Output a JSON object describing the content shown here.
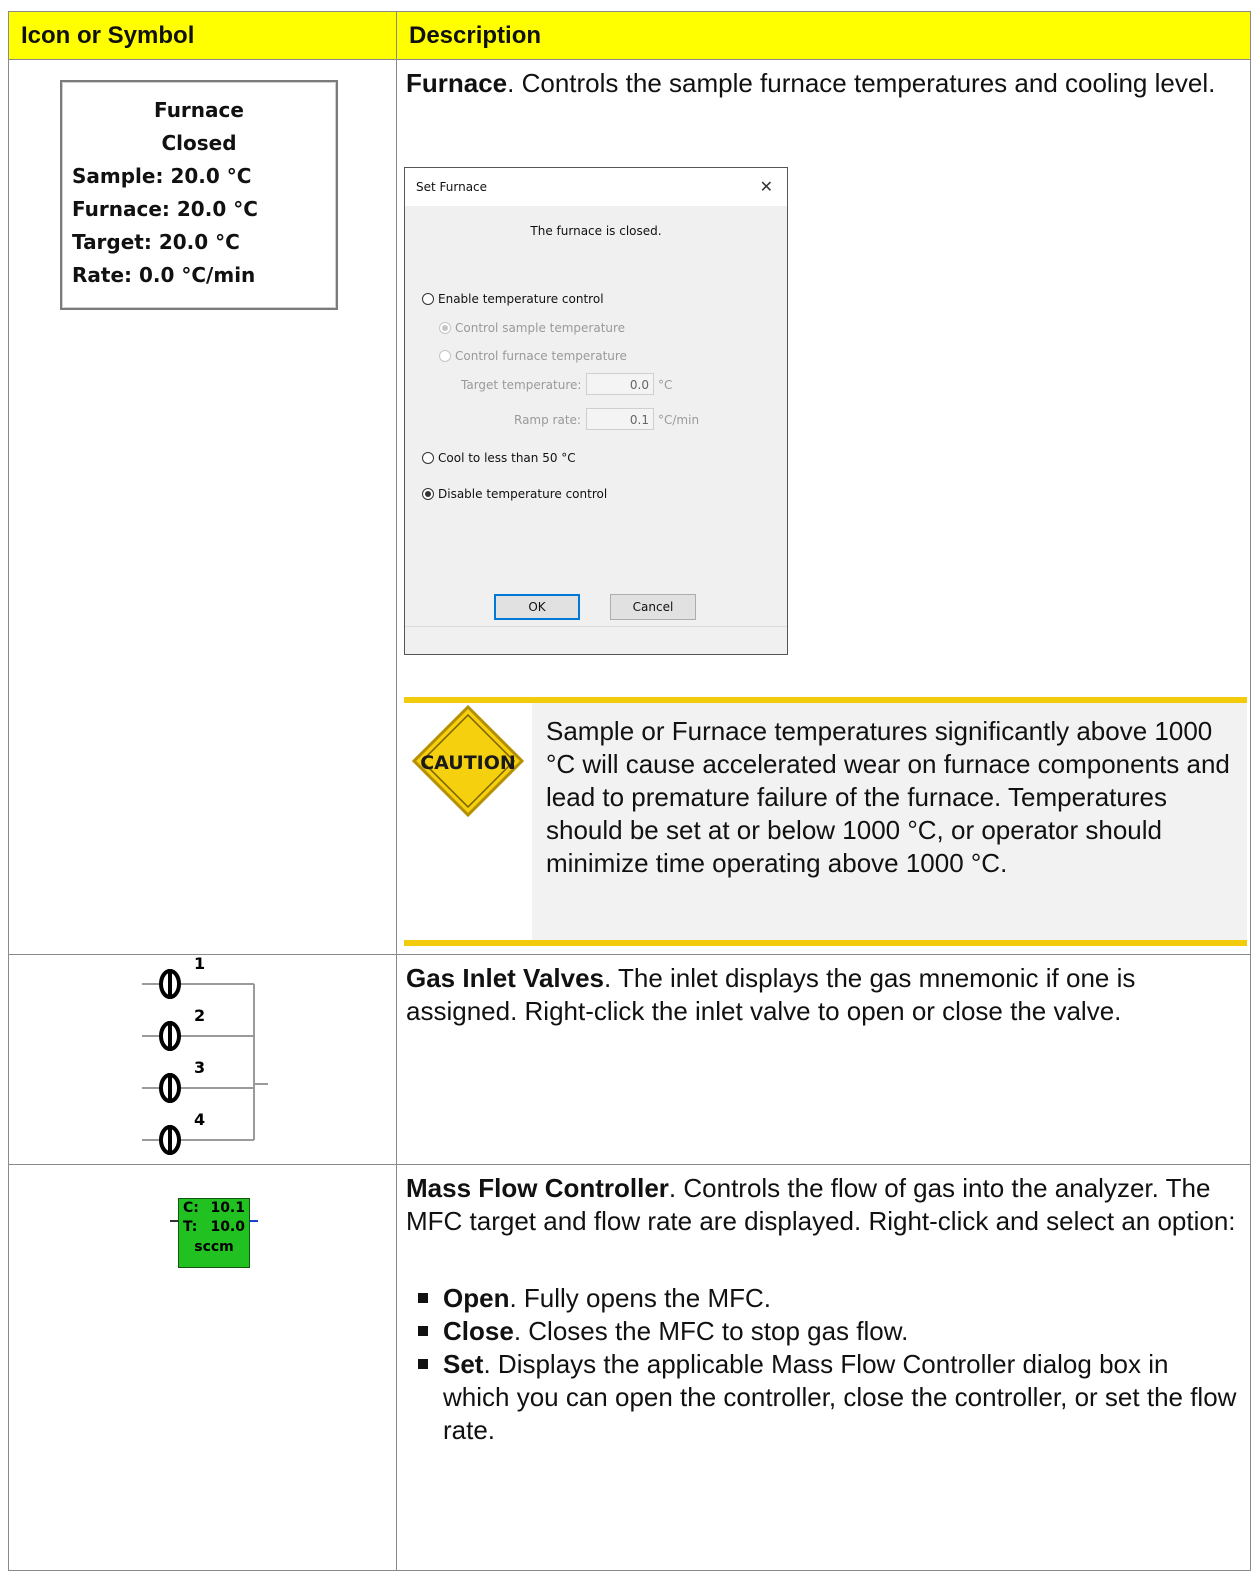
{
  "table": {
    "header_icon": "Icon or Symbol",
    "header_desc": "Description"
  },
  "furnace": {
    "icon": {
      "title": "Furnace",
      "state": "Closed",
      "sample": "Sample: 20.0 °C",
      "furnace": "Furnace: 20.0 °C",
      "target": "Target: 20.0 °C",
      "rate": "Rate: 0.0 °C/min"
    },
    "name": "Furnace",
    "desc": ". Controls the sample furnace temperatures and cooling level.",
    "dialog": {
      "title": "Set Furnace",
      "close": "✕",
      "message": "The furnace is closed.",
      "enable_temp": "Enable temperature control",
      "control_sample": "Control sample temperature",
      "control_furnace": "Control furnace temperature",
      "target_label": "Target temperature:",
      "target_value": "0.0",
      "target_unit": "°C",
      "ramp_label": "Ramp rate:",
      "ramp_value": "0.1",
      "ramp_unit": "°C/min",
      "cool": "Cool to less than 50 °C",
      "disable": "Disable temperature control",
      "ok": "OK",
      "cancel": "Cancel",
      "selected_option": "Disable temperature control"
    },
    "caution": {
      "icon_text": "CAUTION",
      "text": "Sample or Furnace temperatures significantly above 1000 °C will cause accelerated wear on furnace components and lead to premature failure of the furnace. Temperatures should be set at or below 1000 °C, or operator should minimize time operating above 1000 °C."
    }
  },
  "valves": {
    "labels": [
      "1",
      "2",
      "3",
      "4"
    ],
    "name": "Gas Inlet Valves",
    "desc": ". The inlet displays the gas mnemonic if one is assigned. Right-click the inlet valve to open or close the valve."
  },
  "mfc": {
    "c_label": "C:",
    "c_value": "10.1",
    "t_label": "T:",
    "t_value": "10.0",
    "unit": "sccm",
    "name": "Mass Flow Controller",
    "desc": ". Controls the flow of gas into the analyzer. The MFC target and flow rate are displayed. Right-click and select an option:",
    "options": [
      {
        "name": "Open",
        "desc": ". Fully opens the MFC."
      },
      {
        "name": "Close",
        "desc": ". Closes the MFC to stop gas flow."
      },
      {
        "name": "Set",
        "desc": ". Displays the applicable Mass Flow Controller dialog box in which you can open the controller, close the controller, or set the flow rate."
      }
    ],
    "colors": {
      "fill": "#22c122"
    }
  },
  "colors": {
    "header_bg": "#ffff00",
    "caution_bar": "#f2cc0c",
    "caution_panel": "#f2f2f2"
  }
}
